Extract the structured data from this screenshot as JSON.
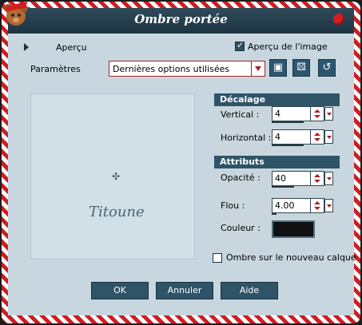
{
  "window": {
    "title": "Ombre portée"
  },
  "top": {
    "preview_label": "Aperçu",
    "image_preview_label": "Aperçu de l'image",
    "image_preview_checked": true
  },
  "params": {
    "label": "Paramètres",
    "preset_value": "Dernières options utilisées",
    "icons": [
      "save-icon",
      "dice-icon",
      "reset-icon"
    ]
  },
  "preview": {
    "watermark_text": "Titoune"
  },
  "offset": {
    "header": "Décalage",
    "vertical_label": "Vertical :",
    "vertical_value": "4",
    "horizontal_label": "Horizontal :",
    "horizontal_value": "4"
  },
  "attributes": {
    "header": "Attributs",
    "opacity_label": "Opacité :",
    "opacity_value": "40",
    "blur_label": "Flou :",
    "blur_value": "4.00",
    "color_label": "Couleur :",
    "color": "#111111"
  },
  "shadow_layer": {
    "label": "Ombre sur le nouveau calque",
    "checked": false
  },
  "buttons": {
    "ok": "OK",
    "cancel": "Annuler",
    "help": "Aide"
  },
  "colors": {
    "accent_red": "#aa1f25",
    "panel_blue": "#2f5468",
    "background": "#c8d7df"
  }
}
